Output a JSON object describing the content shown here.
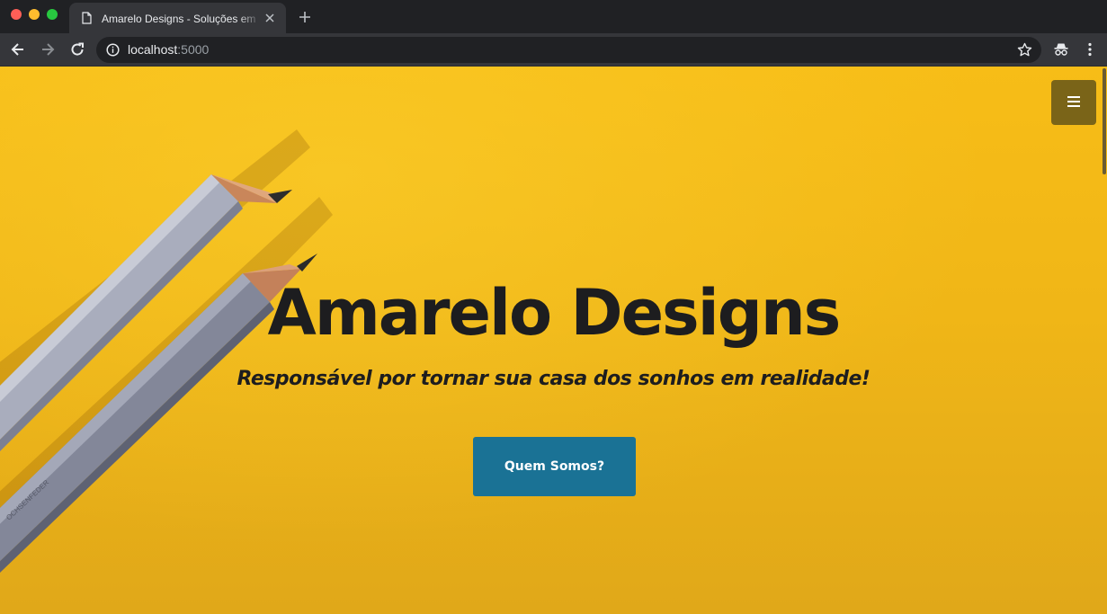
{
  "browser": {
    "tab_title": "Amarelo Designs - Soluções em",
    "url_host": "localhost",
    "url_port": ":5000"
  },
  "colors": {
    "page_background": "#f0b617",
    "menu_button": "#7a6418",
    "cta_button": "#1a7295",
    "heading_text": "#1d1d1f"
  },
  "icons": {
    "menu": "hamburger-icon",
    "back": "back-arrow-icon",
    "forward": "forward-arrow-icon",
    "reload": "reload-icon",
    "info": "info-icon",
    "bookmark": "star-icon",
    "incognito": "incognito-icon",
    "more": "more-vert-icon"
  },
  "hero": {
    "title": "Amarelo Designs",
    "subtitle": "Responsável por tornar sua casa dos sonhos em realidade!",
    "cta_label": "Quem Somos?"
  }
}
